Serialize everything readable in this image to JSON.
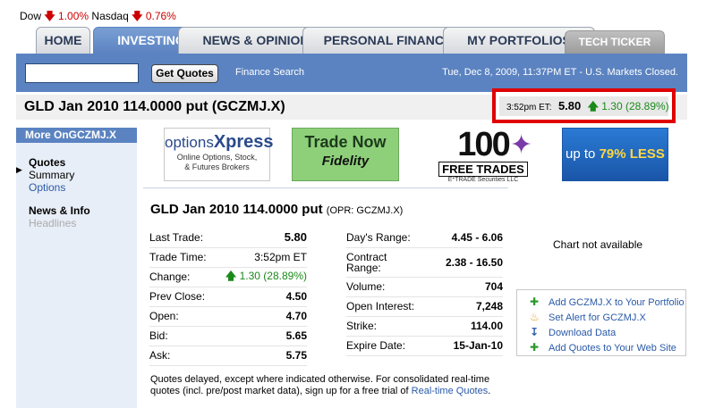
{
  "ticker": {
    "dow_label": "Dow",
    "dow_change": "1.00%",
    "nasdaq_label": "Nasdaq",
    "nasdaq_change": "0.76%"
  },
  "tabs": [
    {
      "label": "HOME"
    },
    {
      "label": "INVESTING"
    },
    {
      "label": "NEWS & OPINION"
    },
    {
      "label": "PERSONAL FINANCE"
    },
    {
      "label": "MY PORTFOLIOS"
    },
    {
      "label": "TECH TICKER"
    }
  ],
  "search": {
    "value": "",
    "button_label": "Get Quotes",
    "link_label": "Finance Search",
    "market_status": "Tue, Dec 8, 2009, 11:37PM ET - U.S. Markets Closed."
  },
  "header": {
    "title": "GLD Jan 2010 114.0000 put (GCZMJ.X)",
    "quote_time": "3:52pm ET:",
    "quote_price": "5.80",
    "quote_change": "1.30 (28.89%)"
  },
  "sidebar": {
    "heading": "More OnGCZMJ.X",
    "quotes_head": "Quotes",
    "quotes_summary": "Summary",
    "quotes_options": "Options",
    "news_head": "News & Info",
    "news_headlines": "Headlines"
  },
  "ads": {
    "optionsxpress_brand_a": "options",
    "optionsxpress_brand_b": "Xpress",
    "optionsxpress_line1": "Online Options, Stock,",
    "optionsxpress_line2": "& Futures Brokers",
    "fidelity_line1": "Trade Now",
    "fidelity_line2": "Fidelity",
    "etrade_big": "100",
    "etrade_free": "FREE TRADES",
    "etrade_small": "E*TRADE Securities LLC",
    "lowcost_pre": "up to ",
    "lowcost_pct": "79%",
    "lowcost_post": " LESS"
  },
  "main": {
    "title": "GLD Jan 2010 114.0000 put",
    "opr": "(OPR: GCZMJ.X)",
    "left_rows": [
      {
        "label": "Last Trade:",
        "value": "5.80"
      },
      {
        "label": "Trade Time:",
        "value": "3:52pm ET"
      },
      {
        "label": "Change:",
        "value": "1.30 (28.89%)"
      },
      {
        "label": "Prev Close:",
        "value": "4.50"
      },
      {
        "label": "Open:",
        "value": "4.70"
      },
      {
        "label": "Bid:",
        "value": "5.65"
      },
      {
        "label": "Ask:",
        "value": "5.75"
      }
    ],
    "right_rows": [
      {
        "label": "Day's Range:",
        "value": "4.45 - 6.06"
      },
      {
        "label": "Contract Range:",
        "value": "2.38 - 16.50"
      },
      {
        "label": "Volume:",
        "value": "704"
      },
      {
        "label": "Open Interest:",
        "value": "7,248"
      },
      {
        "label": "Strike:",
        "value": "114.00"
      },
      {
        "label": "Expire Date:",
        "value": "15-Jan-10"
      }
    ],
    "disclaimer": "Quotes delayed, except where indicated otherwise. For consolidated real-time quotes (incl. pre/post market data), sign up for a free trial of ",
    "disclaimer_link": "Real-time Quotes",
    "disclaimer_end": "."
  },
  "chart": {
    "message": "Chart not available"
  },
  "actions": [
    {
      "label": "Add GCZMJ.X to Your Portfolio",
      "icon": "plus-icon"
    },
    {
      "label": "Set Alert for GCZMJ.X",
      "icon": "bell-icon"
    },
    {
      "label": "Download Data",
      "icon": "download-icon"
    },
    {
      "label": "Add Quotes to Your Web Site",
      "icon": "plus-icon"
    }
  ],
  "colors": {
    "brand_blue": "#5b83c1",
    "down_red": "#cc0000",
    "up_green": "#1a8a1a",
    "link_blue": "#2a5aa8"
  }
}
